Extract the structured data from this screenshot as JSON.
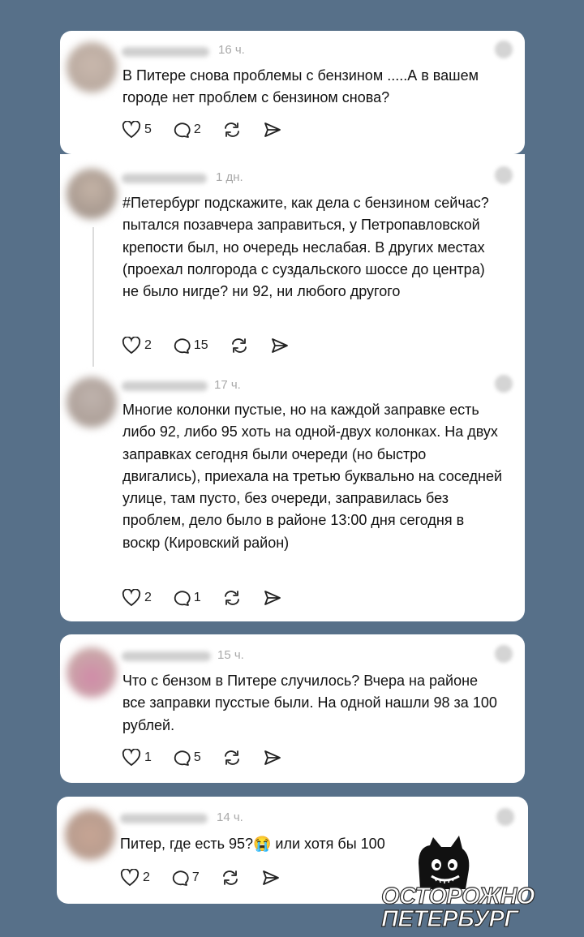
{
  "posts": [
    {
      "time": "16 ч.",
      "text": "В Питере снова проблемы с бензином .....А в вашем городе нет проблем с бензином снова?",
      "likes": "5",
      "replies": "2"
    },
    {
      "time": "1 дн.",
      "text": "#Петербург подскажите, как дела с бензином сейчас? пытался позавчера заправиться, у Петропавловской крепости был, но очередь неслабая. В других местах (проехал полгорода с суздальского шоссе до центра) не было нигде? ни 92, ни любого другого",
      "likes": "2",
      "replies": "15"
    },
    {
      "time": "17 ч.",
      "text": "Многие колонки пустые, но на каждой заправке есть либо 92, либо 95 хоть на одной-двух колонках. На двух заправках сегодня были очереди (но быстро двигались), приехала на третью буквально на соседней улице, там пусто, без очереди, заправилась без проблем, дело было в районе 13:00 дня сегодня в воскр (Кировский район)",
      "likes": "2",
      "replies": "1"
    },
    {
      "time": "15 ч.",
      "text": "Что с бензом в Питере случилось? Вчера на районе все заправки пусстые были. На одной нашли 98 за 100 рублей.",
      "likes": "1",
      "replies": "5"
    },
    {
      "time": "14 ч.",
      "text": "Питер, где есть 95?😭 или хотя бы 100",
      "likes": "2",
      "replies": "7"
    }
  ],
  "watermark": {
    "line1": "ОСТОРОЖНО",
    "line2": "ПЕТЕРБУРГ"
  },
  "icons": [
    "heart-icon",
    "comment-icon",
    "repost-icon",
    "share-icon",
    "more-icon"
  ],
  "colors": {
    "background": "#577089",
    "card": "#ffffff"
  }
}
